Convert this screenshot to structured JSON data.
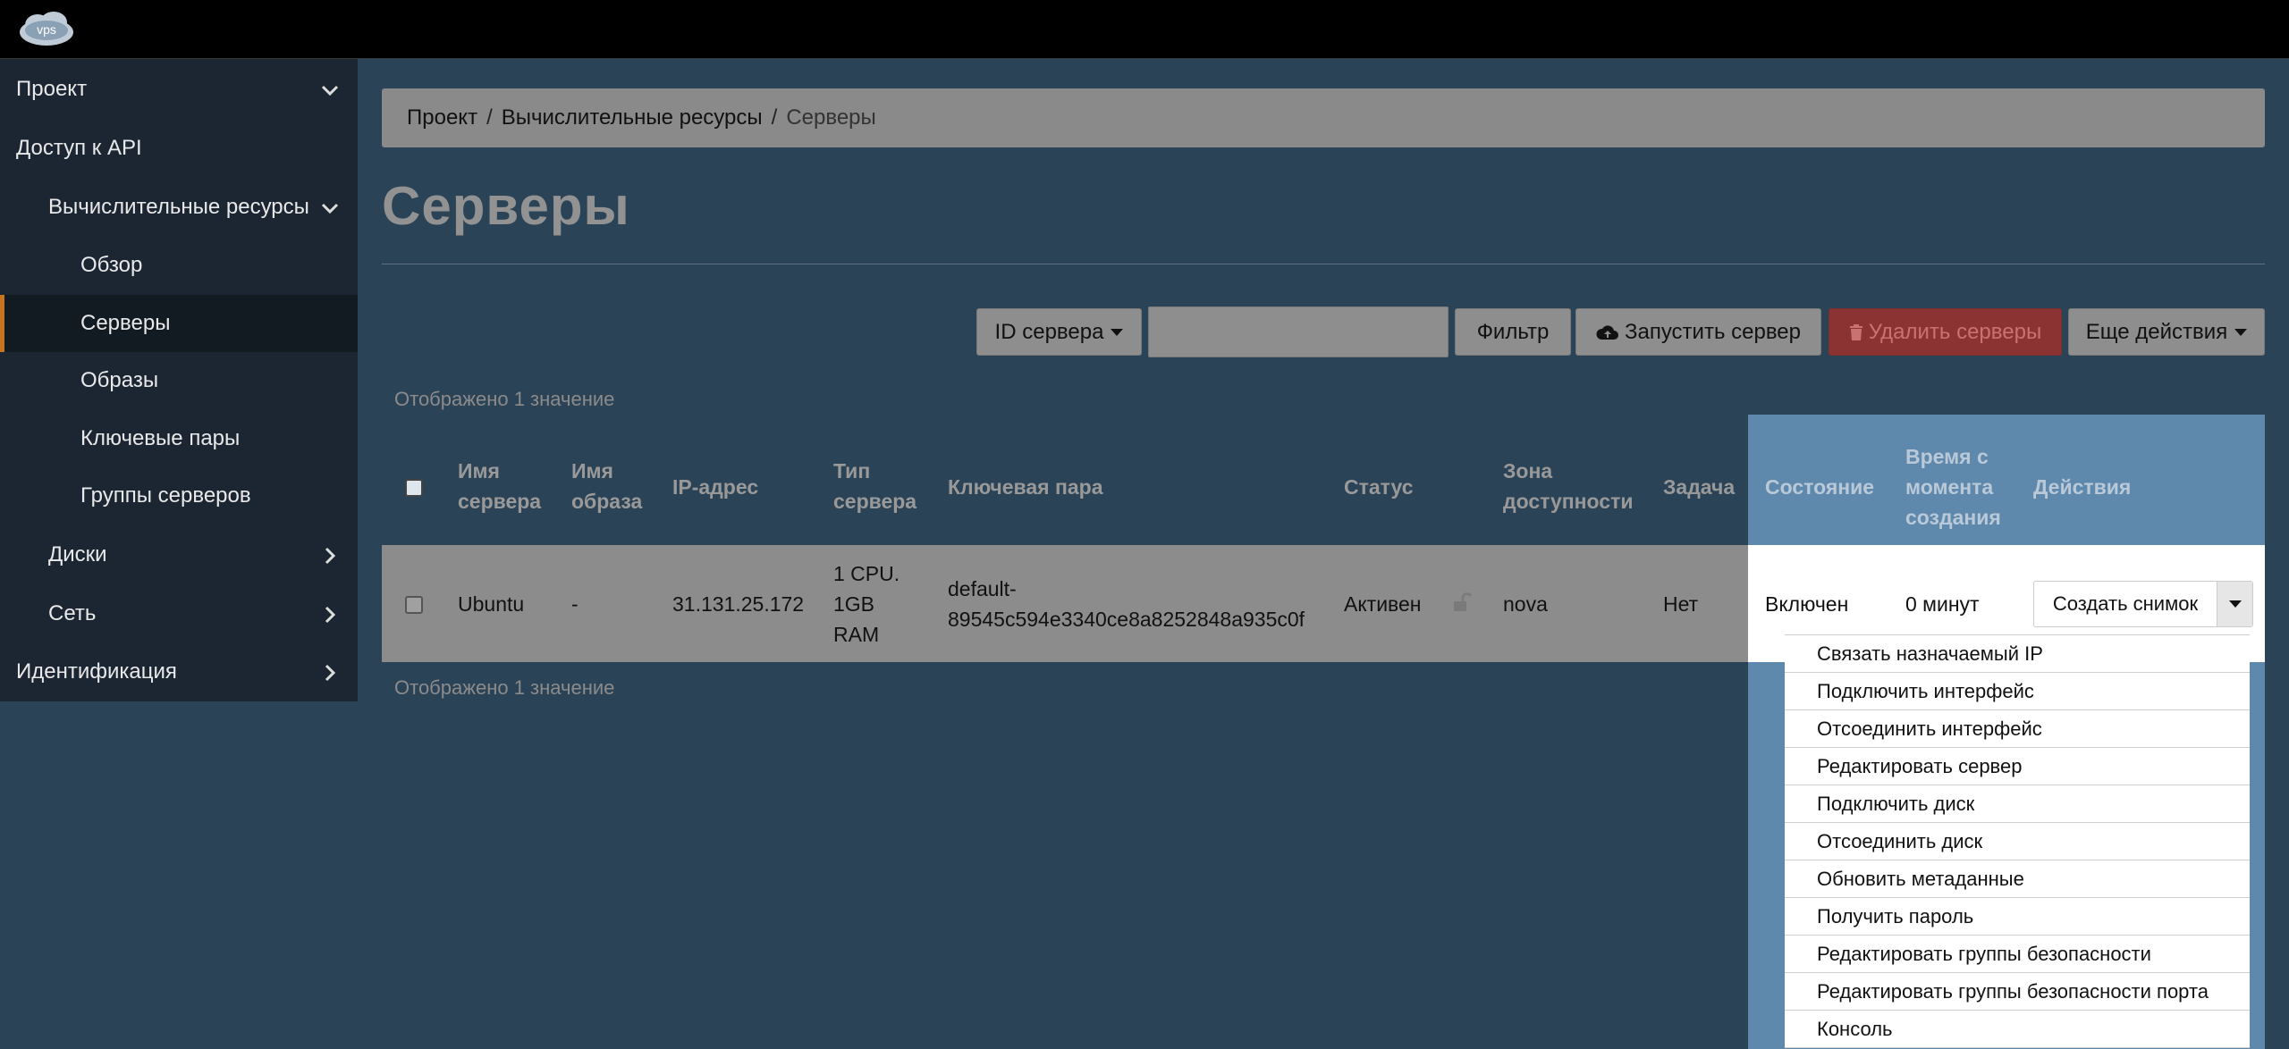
{
  "header": {
    "logo_text": "vps"
  },
  "sidebar": {
    "items": [
      {
        "label": "Проект"
      },
      {
        "label": "Доступ к API"
      },
      {
        "label": "Вычислительные ресурсы"
      },
      {
        "label": "Обзор"
      },
      {
        "label": "Серверы"
      },
      {
        "label": "Образы"
      },
      {
        "label": "Ключевые пары"
      },
      {
        "label": "Группы серверов"
      },
      {
        "label": "Диски"
      },
      {
        "label": "Сеть"
      },
      {
        "label": "Идентификация"
      }
    ]
  },
  "breadcrumb": {
    "items": [
      "Проект",
      "Вычислительные ресурсы",
      "Серверы"
    ],
    "separator": "/"
  },
  "page": {
    "title": "Серверы"
  },
  "toolbar": {
    "filter_field_label": "ID сервера",
    "search_value": "",
    "filter_label": "Фильтр",
    "launch_label": "Запустить сервер",
    "delete_label": "Удалить серверы",
    "more_label": "Еще действия"
  },
  "table": {
    "count_text": "Отображено 1 значение",
    "headers": {
      "name": [
        "Имя",
        "сервера"
      ],
      "image": [
        "Имя",
        "образа"
      ],
      "ip": [
        "IP-адрес"
      ],
      "type": [
        "Тип",
        "сервера"
      ],
      "keypair": [
        "Ключевая пара"
      ],
      "status": [
        "Статус"
      ],
      "zone": [
        "Зона",
        "доступности"
      ],
      "task": [
        "Задача"
      ],
      "state": [
        "Состояние"
      ],
      "age": [
        "Время с",
        "момента",
        "создания"
      ],
      "actions": [
        "Действия"
      ]
    },
    "rows": [
      {
        "name": "Ubuntu",
        "image": "-",
        "ip": "31.131.25.172",
        "type": [
          "1 CPU.",
          "1GB",
          "RAM"
        ],
        "keypair": [
          "default-",
          "89545c594e3340ce8a8252848a935c0f"
        ],
        "status": "Активен",
        "zone": "nova",
        "task": "Нет",
        "state": "Включен",
        "age": "0 минут",
        "action_label": "Создать снимок"
      }
    ]
  },
  "action_menu": {
    "items": [
      "Связать назначаемый IP",
      "Подключить интерфейс",
      "Отсоединить интерфейс",
      "Редактировать сервер",
      "Подключить диск",
      "Отсоединить диск",
      "Обновить метаданные",
      "Получить пароль",
      "Редактировать группы безопасности",
      "Редактировать группы безопасности порта",
      "Консоль"
    ]
  }
}
